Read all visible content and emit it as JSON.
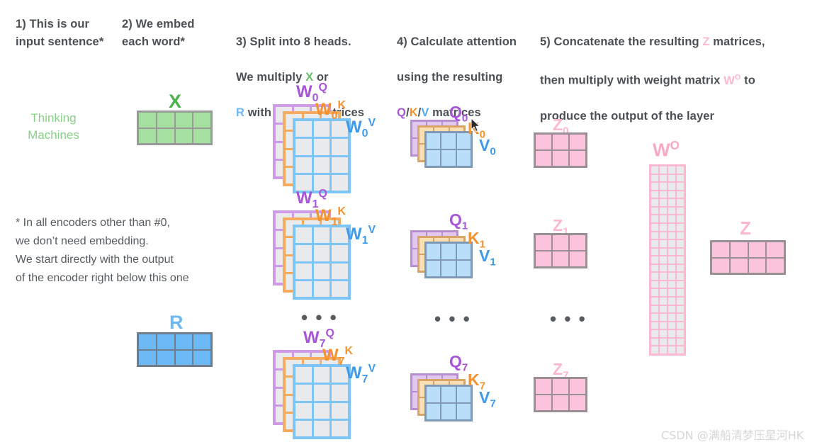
{
  "steps": [
    {
      "id": "step1",
      "text": "1) This is our\ninput sentence*"
    },
    {
      "id": "step2",
      "text": "2) We embed\neach word*"
    },
    {
      "id": "step3",
      "line1": "3) Split into 8 heads.",
      "line2a": "We multiply ",
      "line2b": "X",
      "line2c": " or",
      "line3a": "R",
      "line3b": " with weight matrices"
    },
    {
      "id": "step4",
      "line1": "4) Calculate attention",
      "line2": "using the resulting",
      "q": "Q",
      "sep1": "/",
      "k": "K",
      "sep2": "/",
      "v": "V",
      "line3tail": " matrices"
    },
    {
      "id": "step5",
      "line1a": "5) Concatenate the resulting ",
      "line1z": "Z",
      "line1b": " matrices,",
      "line2a": "then multiply with weight matrix ",
      "line2w": "W",
      "line2sup": "O",
      "line2b": " to",
      "line3": "produce the output of the layer"
    }
  ],
  "footnote": "* In all encoders other than #0,\nwe don’t need embedding.\nWe start directly with the output\nof the encoder right below this one",
  "input_words": "Thinking\nMachines",
  "matrices": {
    "x": {
      "label": "X",
      "rows": 2,
      "cols": 4
    },
    "r": {
      "label": "R",
      "rows": 2,
      "cols": 4
    },
    "z_final": {
      "label": "Z",
      "rows": 2,
      "cols": 4
    },
    "wo": {
      "label_base": "W",
      "label_sup": "O",
      "rows": 23,
      "cols": 4
    },
    "weights": {
      "rows": 4,
      "cols": 3
    },
    "qkv": {
      "rows": 2,
      "cols": 3
    },
    "z": {
      "rows": 2,
      "cols": 3
    }
  },
  "heads": [
    {
      "index": "0",
      "w": {
        "q": {
          "base": "W",
          "sub": "0",
          "sup": "Q"
        },
        "k": {
          "base": "W",
          "sub": "0",
          "sup": "K"
        },
        "v": {
          "base": "W",
          "sub": "0",
          "sup": "V"
        }
      },
      "qkv": {
        "q": {
          "base": "Q",
          "sub": "0"
        },
        "k": {
          "base": "K",
          "sub": "0"
        },
        "v": {
          "base": "V",
          "sub": "0"
        }
      },
      "z": {
        "base": "Z",
        "sub": "0"
      }
    },
    {
      "index": "1",
      "w": {
        "q": {
          "base": "W",
          "sub": "1",
          "sup": "Q"
        },
        "k": {
          "base": "W",
          "sub": "1",
          "sup": "K"
        },
        "v": {
          "base": "W",
          "sub": "1",
          "sup": "V"
        }
      },
      "qkv": {
        "q": {
          "base": "Q",
          "sub": "1"
        },
        "k": {
          "base": "K",
          "sub": "1"
        },
        "v": {
          "base": "V",
          "sub": "1"
        }
      },
      "z": {
        "base": "Z",
        "sub": "1"
      }
    },
    {
      "index": "7",
      "w": {
        "q": {
          "base": "W",
          "sub": "7",
          "sup": "Q"
        },
        "k": {
          "base": "W",
          "sub": "7",
          "sup": "K"
        },
        "v": {
          "base": "W",
          "sub": "7",
          "sup": "V"
        }
      },
      "qkv": {
        "q": {
          "base": "Q",
          "sub": "7"
        },
        "k": {
          "base": "K",
          "sub": "7"
        },
        "v": {
          "base": "V",
          "sub": "7"
        }
      },
      "z": {
        "base": "Z",
        "sub": "7"
      }
    }
  ],
  "ellipsis": "• • •",
  "watermark": "CSDN @满船清梦压星河HK",
  "colors": {
    "green": "#67c066",
    "blue": "#6cb9f5",
    "purple": "#a855d8",
    "orange": "#f49230",
    "pink": "#fbb8d0",
    "text": "#4a5056"
  }
}
